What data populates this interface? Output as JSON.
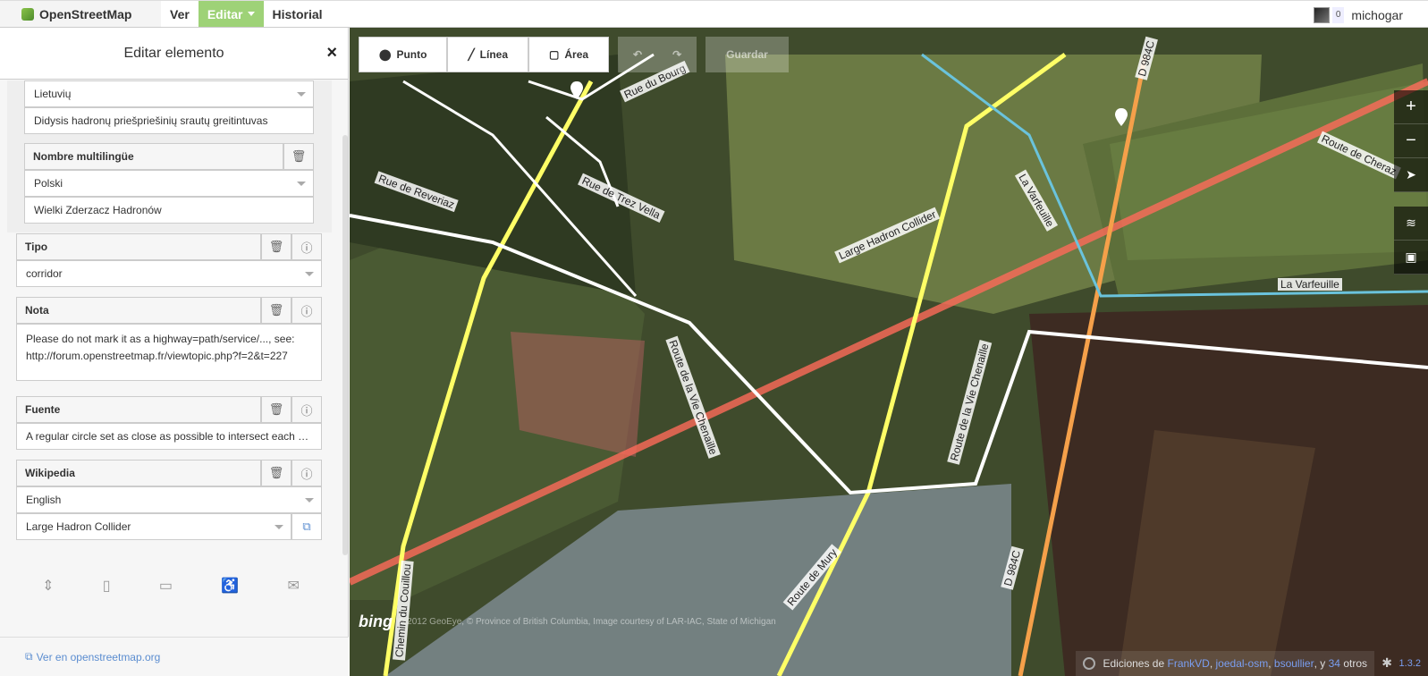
{
  "topbar": {
    "brand": "OpenStreetMap",
    "nav": [
      {
        "label": "Ver"
      },
      {
        "label": "Editar"
      },
      {
        "label": "Historial"
      }
    ],
    "user": {
      "count": "0",
      "name": "michogar"
    }
  },
  "sidebar": {
    "title": "Editar elemento",
    "close": "×",
    "name_multilingual": {
      "lang1": "Lietuvių",
      "value1": "Didysis hadronų priešpriešinių srautų greitintuvas",
      "label": "Nombre multilingüe",
      "lang2": "Polski",
      "value2": "Wielki Zderzacz Hadronów"
    },
    "tipo": {
      "label": "Tipo",
      "value": "corridor"
    },
    "nota": {
      "label": "Nota",
      "line1": "Please do not mark it as a highway=path/service/..., see:",
      "line2": "http://forum.openstreetmap.fr/viewtopic.php?f=2&t=227"
    },
    "fuente": {
      "label": "Fuente",
      "value": "A regular circle set as close as possible to intersect each …"
    },
    "wikipedia": {
      "label": "Wikipedia",
      "lang": "English",
      "article": "Large Hadron Collider"
    },
    "footer_link": "Ver en openstreetmap.org"
  },
  "map": {
    "tools": {
      "point": "Punto",
      "line": "Línea",
      "area": "Área",
      "save": "Guardar"
    },
    "labels": [
      {
        "text": "Rue du Bourg"
      },
      {
        "text": "Rue de Reveriaz"
      },
      {
        "text": "Rue de Trez Vella"
      },
      {
        "text": "Large Hadron Collider"
      },
      {
        "text": "La Varfeuille"
      },
      {
        "text": "La Varfeuille"
      },
      {
        "text": "Route de Cheraz"
      },
      {
        "text": "D 984C"
      },
      {
        "text": "D 984C"
      },
      {
        "text": "Route de la Vie Chenaille"
      },
      {
        "text": "Route de la Vie Chenaille"
      },
      {
        "text": "Chemin du Couillou"
      },
      {
        "text": "Route de Mury"
      }
    ],
    "attribution": "© 2012 GeoEye, © Province of British Columbia, Image courtesy of LAR-IAC, State of Michigan",
    "bing": "bing",
    "edits": {
      "prefix": "Ediciones de",
      "user1": "FrankVD",
      "user2": "joedal-osm",
      "user3": "bsoullier",
      "and": ", y",
      "count": "34",
      "others": "otros"
    },
    "version": "1.3.2"
  }
}
